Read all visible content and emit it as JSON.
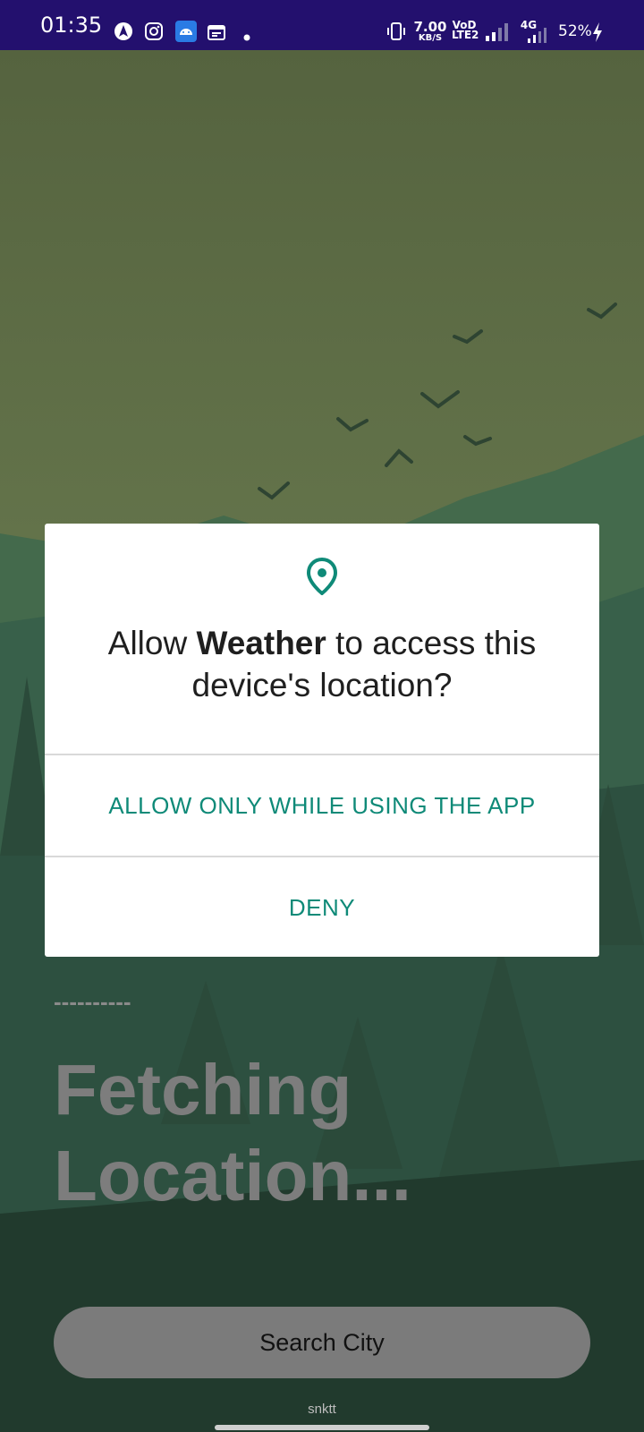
{
  "status_bar": {
    "time": "01:35",
    "net_speed_top": "7.00",
    "net_speed_bottom": "KB/S",
    "volte_top": "VoD",
    "volte_bottom": "LTE2",
    "network_type": "4G",
    "battery": "52%",
    "icons": [
      "autopilot-icon",
      "instagram-icon",
      "android-app-icon",
      "calendar-icon",
      "dot-icon",
      "vibrate-icon",
      "signal-icon",
      "signal-4g-icon",
      "charging-icon"
    ]
  },
  "dialog": {
    "message_prefix": "Allow ",
    "app_name": "Weather",
    "message_suffix": " to access this device's location?",
    "allow_label": "ALLOW ONLY WHILE USING THE APP",
    "deny_label": "DENY",
    "icon": "location-pin-icon",
    "accent_color": "#0f8a78"
  },
  "app": {
    "dashes": "----------",
    "status_text_line1": "Fetching",
    "status_text_line2": "Location...",
    "search_label": "Search City",
    "credit": "snktt"
  }
}
